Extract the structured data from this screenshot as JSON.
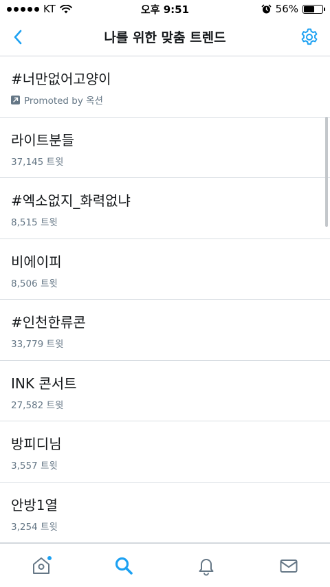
{
  "status_bar": {
    "carrier": "KT",
    "time": "오후 9:51",
    "battery_percent": "56%",
    "battery_level": 0.56
  },
  "nav": {
    "title": "나를 위한 맞춤 트렌드"
  },
  "colors": {
    "accent": "#1da1f2",
    "text_primary": "#14171a",
    "text_secondary": "#657786",
    "divider": "#d8dde2"
  },
  "trends": [
    {
      "name": "#너만없어고양이",
      "meta": "Promoted by 옥션",
      "promoted": true
    },
    {
      "name": "라이트분들",
      "meta": "37,145 트윗"
    },
    {
      "name": "#엑소없지_화력없냐",
      "meta": "8,515 트윗"
    },
    {
      "name": "비에이피",
      "meta": "8,506 트윗"
    },
    {
      "name": "#인천한류콘",
      "meta": "33,779 트윗"
    },
    {
      "name": "INK 콘서트",
      "meta": "27,582 트윗"
    },
    {
      "name": "방피디님",
      "meta": "3,557 트윗"
    },
    {
      "name": "안방1열",
      "meta": "3,254 트윗"
    }
  ],
  "tab_bar": {
    "icons": [
      "home-icon",
      "search-icon",
      "notifications-icon",
      "messages-icon"
    ],
    "active": "search-icon"
  }
}
